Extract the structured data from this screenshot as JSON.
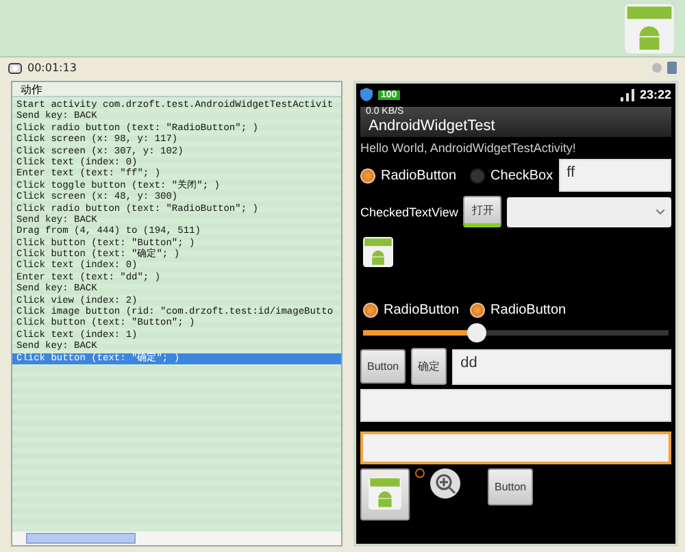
{
  "toolbar": {
    "time": "00:01:13"
  },
  "log": {
    "header": "动作",
    "lines": [
      {
        "text": "Start activity com.drzoft.test.AndroidWidgetTestActivit",
        "selected": false
      },
      {
        "text": "Send key: BACK",
        "selected": false
      },
      {
        "text": "Click radio button (text: \"RadioButton\"; )",
        "selected": false
      },
      {
        "text": "Click screen (x: 98, y: 117)",
        "selected": false
      },
      {
        "text": "Click screen (x: 307, y: 102)",
        "selected": false
      },
      {
        "text": "Click text (index: 0)",
        "selected": false
      },
      {
        "text": "Enter text (text: \"ff\"; )",
        "selected": false
      },
      {
        "text": "Click toggle button (text: \"关闭\"; )",
        "selected": false
      },
      {
        "text": "Click screen (x: 48, y: 300)",
        "selected": false
      },
      {
        "text": "Click radio button (text: \"RadioButton\"; )",
        "selected": false
      },
      {
        "text": "Send key: BACK",
        "selected": false
      },
      {
        "text": "Drag from (4, 444) to (194, 511)",
        "selected": false
      },
      {
        "text": "Click button (text: \"Button\"; )",
        "selected": false
      },
      {
        "text": "Click button (text: \"确定\"; )",
        "selected": false
      },
      {
        "text": "Click text (index: 0)",
        "selected": false
      },
      {
        "text": "Enter text (text: \"dd\"; )",
        "selected": false
      },
      {
        "text": "Send key: BACK",
        "selected": false
      },
      {
        "text": "Click view (index: 2)",
        "selected": false
      },
      {
        "text": "Click image button (rid: \"com.drzoft.test:id/imageButto",
        "selected": false
      },
      {
        "text": "Click button (text: \"Button\"; )",
        "selected": false
      },
      {
        "text": "Click text (index: 1)",
        "selected": false
      },
      {
        "text": "Send key: BACK",
        "selected": false
      },
      {
        "text": "Click button (text: \"确定\"; )",
        "selected": true
      }
    ]
  },
  "phone": {
    "status": {
      "battery": "100",
      "clock": "23:22"
    },
    "title": "AndroidWidgetTest",
    "speed": "0.0 KB/S",
    "hello": "Hello World, AndroidWidgetTestActivity!",
    "radio1": {
      "label": "RadioButton",
      "selected": true
    },
    "checkbox": {
      "label": "CheckBox",
      "checked": false
    },
    "field1": {
      "value": "ff"
    },
    "checked_text": "CheckedTextView",
    "toggle": {
      "label": "打开",
      "on": true
    },
    "radios": [
      {
        "label": "RadioButton",
        "selected": true
      },
      {
        "label": "RadioButton",
        "selected": true
      }
    ],
    "seekbar": {
      "level": 0.37
    },
    "button1": "Button",
    "button2": "确定",
    "field2": {
      "value": "dd"
    },
    "field4": {
      "focused": true
    },
    "small_radio": {
      "selected": false
    },
    "button3": "Button"
  }
}
